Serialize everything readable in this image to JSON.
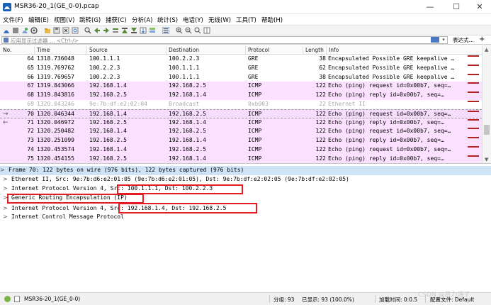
{
  "window": {
    "title": "MSR36-20_1(GE_0-0).pcap",
    "minimize": "—",
    "maximize": "☐",
    "close": "✕"
  },
  "menu": [
    "文件(F)",
    "编辑(E)",
    "视图(V)",
    "跳转(G)",
    "捕获(C)",
    "分析(A)",
    "统计(S)",
    "电话(Y)",
    "无线(W)",
    "工具(T)",
    "帮助(H)"
  ],
  "filter": {
    "placeholder": "应用显示过滤器 … <Ctrl-/>",
    "expression_label": "表达式…",
    "add_label": "+"
  },
  "columns": [
    "No.",
    "Time",
    "Source",
    "Destination",
    "Protocol",
    "Length",
    "Info"
  ],
  "packets": [
    {
      "no": "64",
      "time": "1318.736048",
      "src": "100.1.1.1",
      "dst": "100.2.2.3",
      "proto": "GRE",
      "len": "38",
      "info": "Encapsulated Possible GRE keepalive …",
      "bg": "white",
      "arrow": ""
    },
    {
      "no": "65",
      "time": "1319.769762",
      "src": "100.2.2.3",
      "dst": "100.1.1.1",
      "proto": "GRE",
      "len": "62",
      "info": "Encapsulated Possible GRE keepalive …",
      "bg": "white",
      "arrow": ""
    },
    {
      "no": "66",
      "time": "1319.769657",
      "src": "100.2.2.3",
      "dst": "100.1.1.1",
      "proto": "GRE",
      "len": "38",
      "info": "Encapsulated Possible GRE keepalive …",
      "bg": "white",
      "arrow": ""
    },
    {
      "no": "67",
      "time": "1319.843066",
      "src": "192.168.1.4",
      "dst": "192.168.2.5",
      "proto": "ICMP",
      "len": "122",
      "info": "Echo (ping) request  id=0x00b7, seq=…",
      "bg": "pink",
      "arrow": ""
    },
    {
      "no": "68",
      "time": "1319.843816",
      "src": "192.168.2.5",
      "dst": "192.168.1.4",
      "proto": "ICMP",
      "len": "122",
      "info": "Echo (ping) reply    id=0x00b7, seq=…",
      "bg": "pink",
      "arrow": ""
    },
    {
      "no": "69",
      "time": "1320.043246",
      "src": "9e:7b:df:e2:02:04",
      "dst": "Broadcast",
      "proto": "0xb003",
      "len": "22",
      "info": "Ethernet II",
      "bg": "grey",
      "arrow": ""
    },
    {
      "no": "70",
      "time": "1320.046344",
      "src": "192.168.1.4",
      "dst": "192.168.2.5",
      "proto": "ICMP",
      "len": "122",
      "info": "Echo (ping) request  id=0x00b7, seq=…",
      "bg": "sel",
      "arrow": "→"
    },
    {
      "no": "71",
      "time": "1320.046972",
      "src": "192.168.2.5",
      "dst": "192.168.1.4",
      "proto": "ICMP",
      "len": "122",
      "info": "Echo (ping) reply    id=0x00b7, seq=…",
      "bg": "pink",
      "arrow": "←"
    },
    {
      "no": "72",
      "time": "1320.250482",
      "src": "192.168.1.4",
      "dst": "192.168.2.5",
      "proto": "ICMP",
      "len": "122",
      "info": "Echo (ping) request  id=0x00b7, seq=…",
      "bg": "pink",
      "arrow": ""
    },
    {
      "no": "73",
      "time": "1320.251099",
      "src": "192.168.2.5",
      "dst": "192.168.1.4",
      "proto": "ICMP",
      "len": "122",
      "info": "Echo (ping) reply    id=0x00b7, seq=…",
      "bg": "pink",
      "arrow": ""
    },
    {
      "no": "74",
      "time": "1320.453574",
      "src": "192.168.1.4",
      "dst": "192.168.2.5",
      "proto": "ICMP",
      "len": "122",
      "info": "Echo (ping) request  id=0x00b7, seq=…",
      "bg": "pink",
      "arrow": ""
    },
    {
      "no": "75",
      "time": "1320.454155",
      "src": "192.168.2.5",
      "dst": "192.168.1.4",
      "proto": "ICMP",
      "len": "122",
      "info": "Echo (ping) reply    id=0x00b7, seq=…",
      "bg": "pink",
      "arrow": ""
    }
  ],
  "details": [
    {
      "tw": ">",
      "text": "Frame 70: 122 bytes on wire (976 bits), 122 bytes captured (976 bits)",
      "sel": true
    },
    {
      "tw": ">",
      "text": "Ethernet II, Src: 9e:7b:d6:e2:01:05 (9e:7b:d6:e2:01:05), Dst: 9e:7b:df:e2:02:05 (9e:7b:df:e2:02:05)",
      "sel": false
    },
    {
      "tw": ">",
      "text": "Internet Protocol Version 4, Src: 100.1.1.1, Dst: 100.2.2.3",
      "sel": false
    },
    {
      "tw": ">",
      "text": "Generic Routing Encapsulation (IP)",
      "sel": false
    },
    {
      "tw": ">",
      "text": "Internet Protocol Version 4, Src: 192.168.1.4, Dst: 192.168.2.5",
      "sel": false
    },
    {
      "tw": ">",
      "text": "Internet Control Message Protocol",
      "sel": false
    }
  ],
  "status": {
    "file": "MSR36-20_1(GE_0-0)",
    "packets": "分组: 93",
    "displayed": "已显示: 93 (100.0%)",
    "load_time": "加载时间: 0:0.5",
    "profile": "配置文件: Default"
  },
  "watermark": "CSDN @吕力涛子",
  "colors": {
    "pink_row": "#fce0ff",
    "selected_detail": "#cfe3f7",
    "annotation_red": "#e51c23"
  }
}
